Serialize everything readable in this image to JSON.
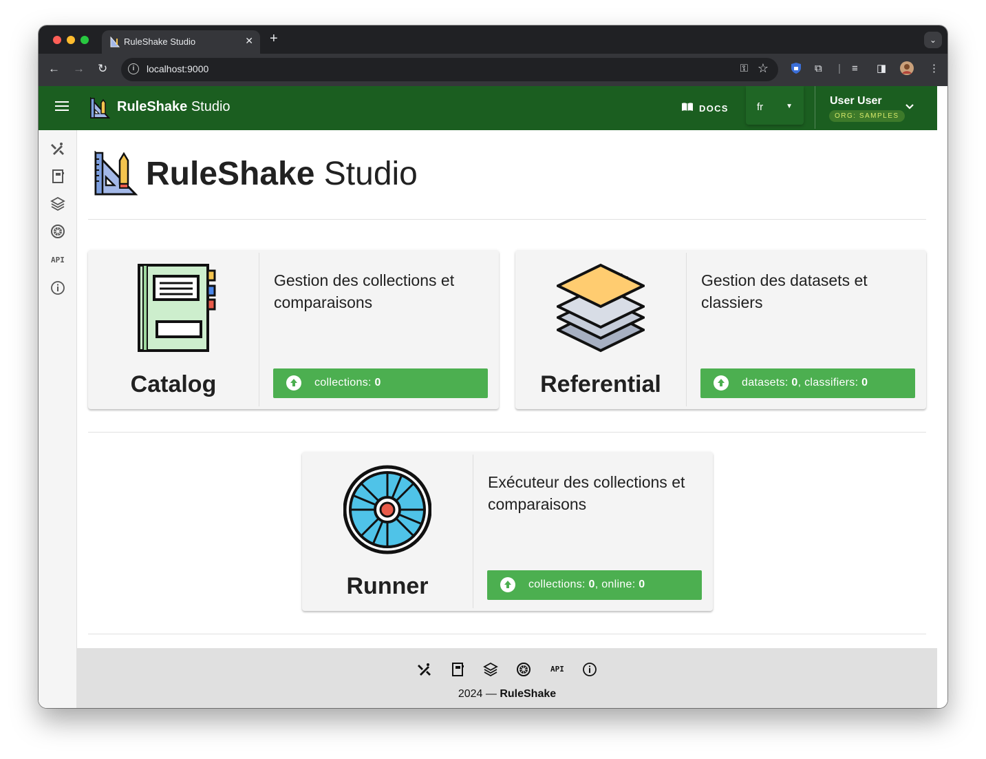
{
  "browser": {
    "tab_title": "RuleShake Studio",
    "url": "localhost:9000",
    "new_tab": "+",
    "tab_close": "✕"
  },
  "appbar": {
    "brand_bold": "RuleShake",
    "brand_light": " Studio",
    "docs_label": "DOCS",
    "language": "fr",
    "user_name": "User User",
    "org_label": "ORG: SAMPLES"
  },
  "sidebar": {
    "items": [
      {
        "icon": "design-tools-icon"
      },
      {
        "icon": "notebook-icon"
      },
      {
        "icon": "layers-icon"
      },
      {
        "icon": "turbine-icon"
      },
      {
        "icon": "api-icon",
        "label": "API"
      },
      {
        "icon": "info-icon"
      }
    ]
  },
  "hero": {
    "title_bold": "RuleShake",
    "title_light": " Studio"
  },
  "cards": [
    {
      "title": "Catalog",
      "description": "Gestion des collections et comparaisons",
      "stats": [
        {
          "label": "collections: ",
          "value": "0"
        }
      ]
    },
    {
      "title": "Referential",
      "description": "Gestion des datasets et classiers",
      "stats": [
        {
          "label": "datasets: ",
          "value": "0"
        },
        {
          "label": ", classifiers: ",
          "value": "0"
        }
      ]
    },
    {
      "title": "Runner",
      "description": "Exécuteur des collections et comparaisons",
      "stats": [
        {
          "label": "collections: ",
          "value": "0"
        },
        {
          "label": ", online: ",
          "value": "0"
        }
      ]
    }
  ],
  "footer": {
    "api_label": "API",
    "year": "2024 — ",
    "brand": "RuleShake"
  },
  "colors": {
    "appbar": "#1b5e20",
    "button": "#4caf50",
    "org_chip_text": "#d7e96a"
  }
}
